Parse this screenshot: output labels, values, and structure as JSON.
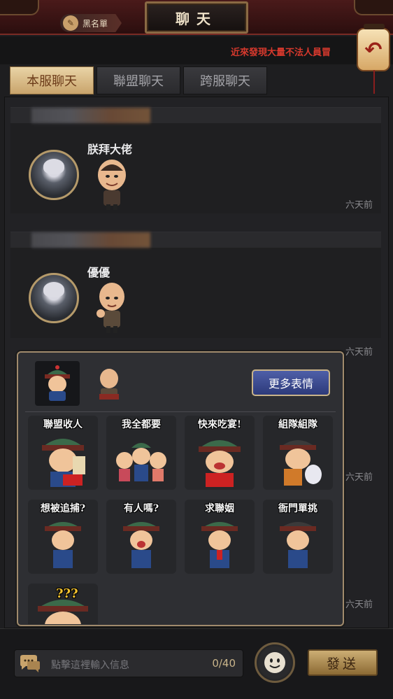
{
  "header": {
    "title": "聊天",
    "blacklist_label": "黑名單",
    "announcement": "近來發現大量不法人員冒",
    "back_icon": "back-arrow-icon"
  },
  "tabs": [
    {
      "label": "本服聊天",
      "active": true
    },
    {
      "label": "聯盟聊天",
      "active": false
    },
    {
      "label": "跨服聊天",
      "active": false
    }
  ],
  "messages": [
    {
      "username": "朕拜大佬",
      "time": "六天前"
    },
    {
      "username": "優優",
      "time": "六天前"
    }
  ],
  "hidden_times": [
    "六天前",
    "六天前",
    "六天前"
  ],
  "sticker_panel": {
    "more_label": "更多表情",
    "stickers": [
      {
        "caption": "聯盟收人"
      },
      {
        "caption": "我全都要"
      },
      {
        "caption": "快來吃宴!"
      },
      {
        "caption": "組隊組隊"
      },
      {
        "caption": "想被追捕?"
      },
      {
        "caption": "有人嗎?"
      },
      {
        "caption": "求聯姻"
      },
      {
        "caption": "衙門單挑"
      },
      {
        "caption": "???"
      }
    ]
  },
  "input": {
    "placeholder": "點擊這裡輸入信息",
    "counter": "0/40",
    "send_label": "發送"
  },
  "colors": {
    "accent_gold": "#c9a46c",
    "announce_red": "#d7392d",
    "more_button_blue": "#3f4f98"
  }
}
